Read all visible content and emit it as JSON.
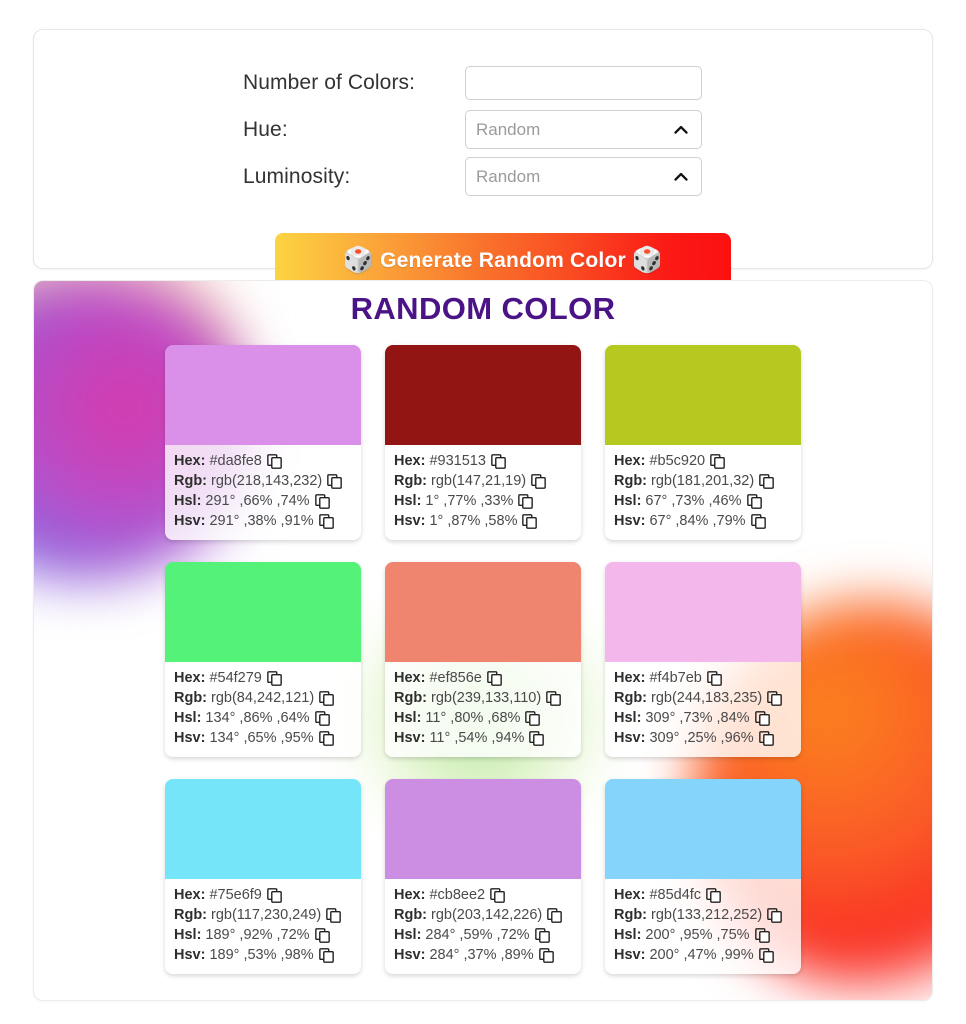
{
  "form": {
    "fields": [
      {
        "label": "Number of Colors:",
        "type": "input",
        "value": "",
        "placeholder": ""
      },
      {
        "label": "Hue:",
        "type": "select",
        "value": "Random"
      },
      {
        "label": "Luminosity:",
        "type": "select",
        "value": "Random"
      }
    ],
    "generate_button": {
      "label": "Generate Random Color",
      "left_icon": "dice-icon",
      "right_icon": "dice-icon",
      "dice_glyph": "🎲"
    },
    "chevron_icon": "chevron-up-icon"
  },
  "results": {
    "title": "RANDOM COLOR",
    "title_color": "#4b1486",
    "copy_icon": "copy-icon",
    "row_labels": {
      "hex": "Hex:",
      "rgb": "Rgb:",
      "hsl": "Hsl:",
      "hsv": "Hsv:"
    },
    "colors": [
      {
        "swatch": "#da8fe8",
        "hex": "#da8fe8",
        "rgb": "rgb(218,143,232)",
        "hsl": "291° ,66% ,74%",
        "hsv": "291° ,38% ,91%"
      },
      {
        "swatch": "#931513",
        "hex": "#931513",
        "rgb": "rgb(147,21,19)",
        "hsl": "1° ,77% ,33%",
        "hsv": "1° ,87% ,58%"
      },
      {
        "swatch": "#b5c920",
        "hex": "#b5c920",
        "rgb": "rgb(181,201,32)",
        "hsl": "67° ,73% ,46%",
        "hsv": "67° ,84% ,79%"
      },
      {
        "swatch": "#54f279",
        "hex": "#54f279",
        "rgb": "rgb(84,242,121)",
        "hsl": "134° ,86% ,64%",
        "hsv": "134° ,65% ,95%"
      },
      {
        "swatch": "#ef856e",
        "hex": "#ef856e",
        "rgb": "rgb(239,133,110)",
        "hsl": "11° ,80% ,68%",
        "hsv": "11° ,54% ,94%"
      },
      {
        "swatch": "#f4b7eb",
        "hex": "#f4b7eb",
        "rgb": "rgb(244,183,235)",
        "hsl": "309° ,73% ,84%",
        "hsv": "309° ,25% ,96%"
      },
      {
        "swatch": "#75e6f9",
        "hex": "#75e6f9",
        "rgb": "rgb(117,230,249)",
        "hsl": "189° ,92% ,72%",
        "hsv": "189° ,53% ,98%"
      },
      {
        "swatch": "#cb8ee2",
        "hex": "#cb8ee2",
        "rgb": "rgb(203,142,226)",
        "hsl": "284° ,59% ,72%",
        "hsv": "284° ,37% ,89%"
      },
      {
        "swatch": "#85d4fc",
        "hex": "#85d4fc",
        "rgb": "rgb(133,212,252)",
        "hsl": "200° ,95% ,75%",
        "hsv": "200° ,47% ,99%"
      }
    ]
  }
}
